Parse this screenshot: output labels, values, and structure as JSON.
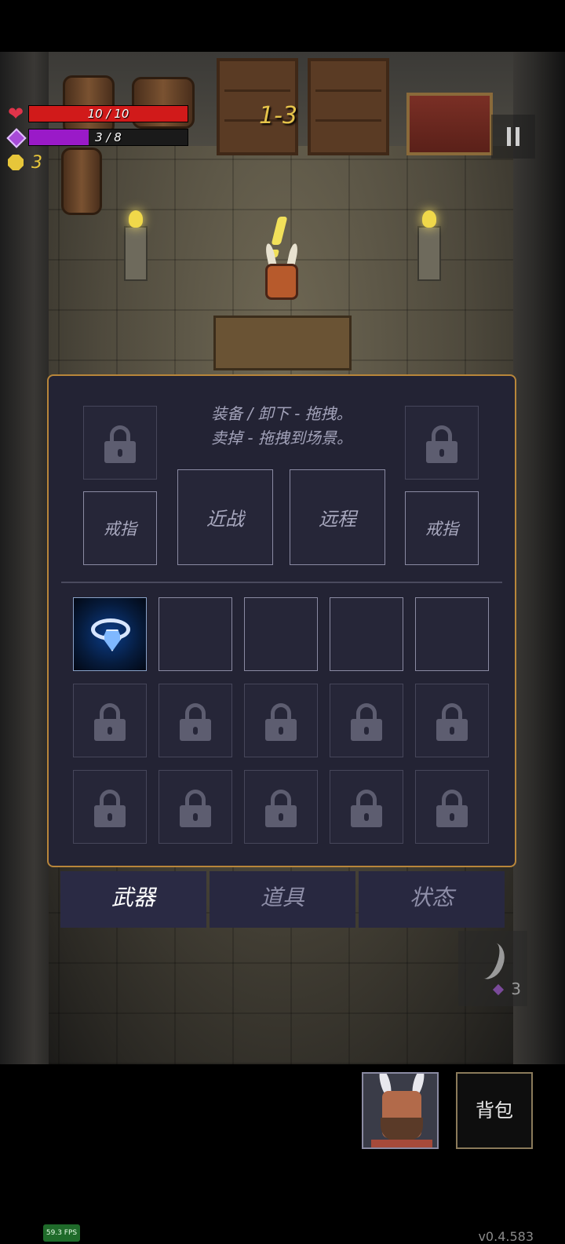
{
  "hud": {
    "hp_text": "10 / 10",
    "hp_fraction": 1.0,
    "mana_text": "3 / 8",
    "mana_fraction": 0.375,
    "gold": "3",
    "level": "1-3",
    "colors": {
      "hp": "#d11a1a",
      "mana": "#9a1ac8",
      "gold": "#e7c63a",
      "level": "#e5c34a"
    }
  },
  "panel": {
    "hint_line1": "装备 / 卸下 - 拖拽。",
    "hint_line2": "卖掉 - 拖拽到场景。",
    "equip_slots": {
      "ring_left": "戒指",
      "melee": "近战",
      "ranged": "远程",
      "ring_right": "戒指"
    },
    "inventory_item": "ring-icon"
  },
  "tabs": [
    {
      "label": "武器",
      "active": true
    },
    {
      "label": "道具",
      "active": false
    },
    {
      "label": "状态",
      "active": false
    }
  ],
  "ability": {
    "cost": "3",
    "icon": "horn-icon"
  },
  "bag_label": "背包",
  "fps": "59.3 FPS",
  "version": "v0.4.583"
}
